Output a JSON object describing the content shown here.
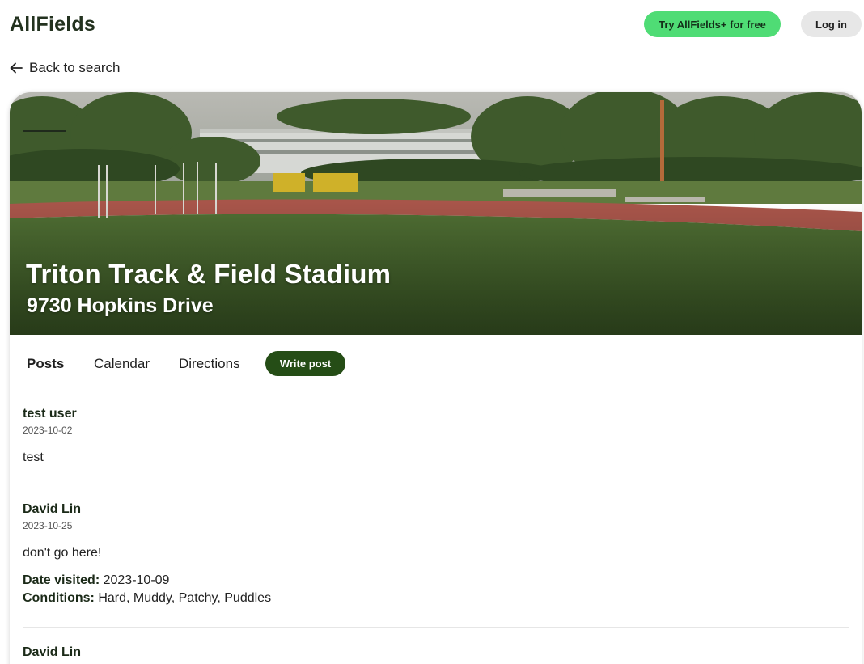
{
  "header": {
    "logo": "AllFields",
    "try_button": "Try AllFields+ for free",
    "login_button": "Log in"
  },
  "nav": {
    "back_label": "Back to search"
  },
  "field": {
    "name": "Triton Track & Field Stadium",
    "address": "9730 Hopkins Drive"
  },
  "tabs": {
    "posts": "Posts",
    "calendar": "Calendar",
    "directions": "Directions",
    "active": "Posts"
  },
  "write_post_label": "Write post",
  "posts": [
    {
      "author": "test user",
      "date": "2023-10-02",
      "body": "test"
    },
    {
      "author": "David Lin",
      "date": "2023-10-25",
      "body": "don't go here!",
      "date_visited_label": "Date visited:",
      "date_visited": "2023-10-09",
      "conditions_label": "Conditions:",
      "conditions": "Hard, Muddy, Patchy, Puddles"
    },
    {
      "author": "David Lin"
    }
  ],
  "colors": {
    "accent_green": "#4fdc75",
    "dark_green": "#254d16",
    "login_bg": "#e7e7e7"
  }
}
